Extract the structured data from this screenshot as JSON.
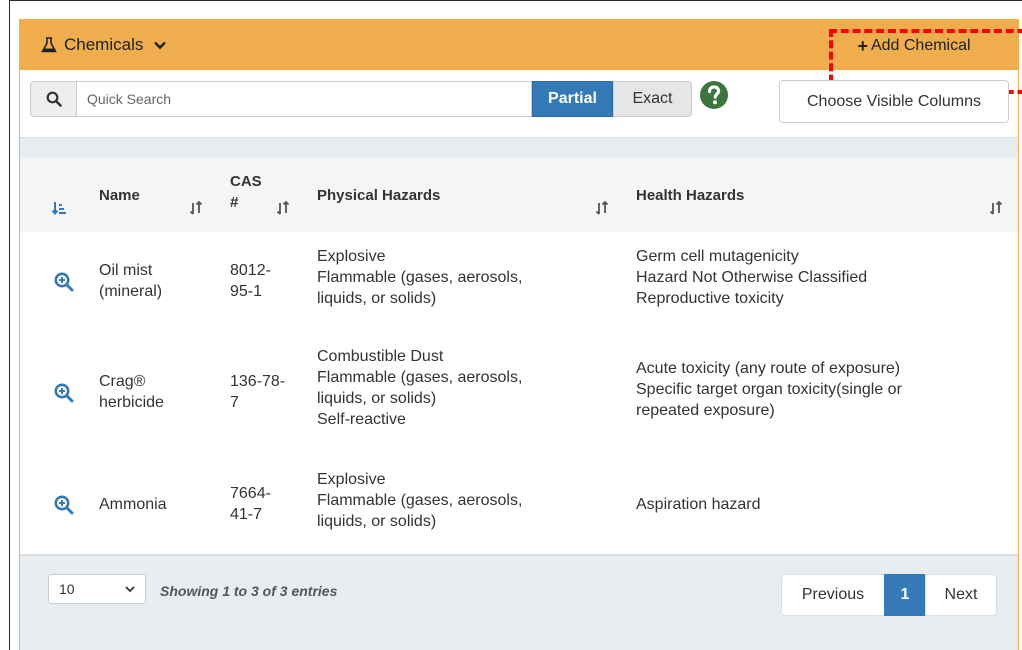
{
  "header": {
    "title": "Chemicals",
    "add_label": "Add Chemical",
    "accent_color": "#f0ad4e"
  },
  "search": {
    "placeholder": "Quick Search",
    "partial_label": "Partial",
    "exact_label": "Exact",
    "choose_columns_label": "Choose Visible Columns"
  },
  "table": {
    "columns": [
      "Name",
      "CAS #",
      "Physical Hazards",
      "Health Hazards"
    ],
    "cas_header_line1": "CAS",
    "cas_header_line2": "#",
    "rows": [
      {
        "name_lines": [
          "Oil mist",
          "(mineral)"
        ],
        "cas_lines": [
          "8012-",
          "95-1"
        ],
        "physical_lines": [
          "Explosive",
          "Flammable (gases, aerosols,",
          "liquids, or solids)"
        ],
        "health_lines": [
          "Germ cell mutagenicity",
          "Hazard Not Otherwise Classified",
          "Reproductive toxicity"
        ]
      },
      {
        "name_lines": [
          "Crag®",
          "herbicide"
        ],
        "cas_lines": [
          "136-78-",
          "7"
        ],
        "physical_lines": [
          "Combustible Dust",
          "Flammable (gases, aerosols,",
          "liquids, or solids)",
          "Self-reactive"
        ],
        "health_lines": [
          "Acute toxicity (any route of exposure)",
          "Specific target organ toxicity(single or",
          "repeated exposure)"
        ]
      },
      {
        "name_lines": [
          "Ammonia"
        ],
        "cas_lines": [
          "7664-",
          "41-7"
        ],
        "physical_lines": [
          "Explosive",
          "Flammable (gases, aerosols,",
          "liquids, or solids)"
        ],
        "health_lines": [
          "Aspiration hazard"
        ]
      }
    ]
  },
  "footer": {
    "page_length": "10",
    "info_text": "Showing 1 to 3 of 3 entries",
    "previous_label": "Previous",
    "current_page": "1",
    "next_label": "Next"
  },
  "icons": {
    "header": "flask-icon",
    "toggle": "chevron-down-icon",
    "search": "search-icon",
    "help": "question-circle-icon",
    "row_action": "zoom-in-icon",
    "sort": "sort-icon"
  },
  "colors": {
    "primary": "#337ab7",
    "help_green": "#3c763d",
    "highlight": "#ff0000"
  }
}
